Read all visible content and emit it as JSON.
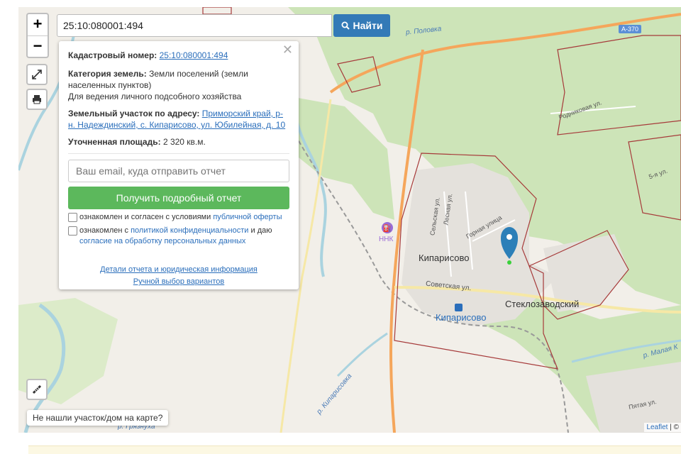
{
  "map": {
    "places": {
      "kiparisovo": "Кипарисово",
      "steklozavodskiy": "Стеклозаводский",
      "station": "Кипарисово",
      "fuel": "ННК"
    },
    "streets": {
      "selskaya": "Сельская ул.",
      "lesnaya": "Лесная ул.",
      "gornaya": "Горная улица",
      "sovetskaya": "Советская ул.",
      "rodnikovaya": "Родниковая ул.",
      "pyataya_1": "5-я ул.",
      "pyataya_2": "Пятая ул."
    },
    "rivers": {
      "polovka": "р. Половка",
      "kiparisovka": "р. Кипарисовка",
      "malaya": "р. Малая К",
      "gryaznukha": "р. Грязнуха"
    },
    "road_shield": "А-370"
  },
  "search": {
    "value": "25:10:080001:494",
    "button_label": "Найти"
  },
  "popup": {
    "cadastral_label": "Кадастровый номер:",
    "cadastral_value": "25:10:080001:494",
    "category_label": "Категория земель:",
    "category_value": "Земли поселений (земли населенных пунктов)",
    "use_value": "Для ведения личного подсобного хозяйства",
    "address_label": "Земельный участок по адресу:",
    "address_value": "Приморский край, р-н. Надеждинский, с. Кипарисово, ул. Юбилейная, д. 10",
    "area_label": "Уточненная площадь:",
    "area_value": "2 320 кв.м.",
    "email_placeholder": "Ваш email, куда отправить отчет",
    "get_report": "Получить подробный отчет",
    "consent1_prefix": "ознакомлен и согласен с условиями ",
    "consent1_link": "публичной оферты",
    "consent2_prefix": "ознакомлен с ",
    "consent2_link": "политикой конфиденциальности",
    "consent2_mid": " и даю ",
    "consent2_link2": "согласие на обработку персональных данных",
    "details_link": "Детали отчета и юридическая информация",
    "manual_link": "Ручной выбор вариантов"
  },
  "controls": {
    "zoom_in": "+",
    "zoom_out": "−",
    "not_found": "Не нашли участок/дом на карте?"
  },
  "attribution": {
    "leaflet": "Leaflet",
    "sep": " | ©"
  },
  "colors": {
    "forest": "#cde4b8",
    "road_main": "#f5a65b",
    "parcel": "#a63a3a",
    "water": "#aad3df",
    "marker": "#2c7fb8",
    "button_blue": "#337ab7",
    "button_green": "#5cb85c"
  }
}
